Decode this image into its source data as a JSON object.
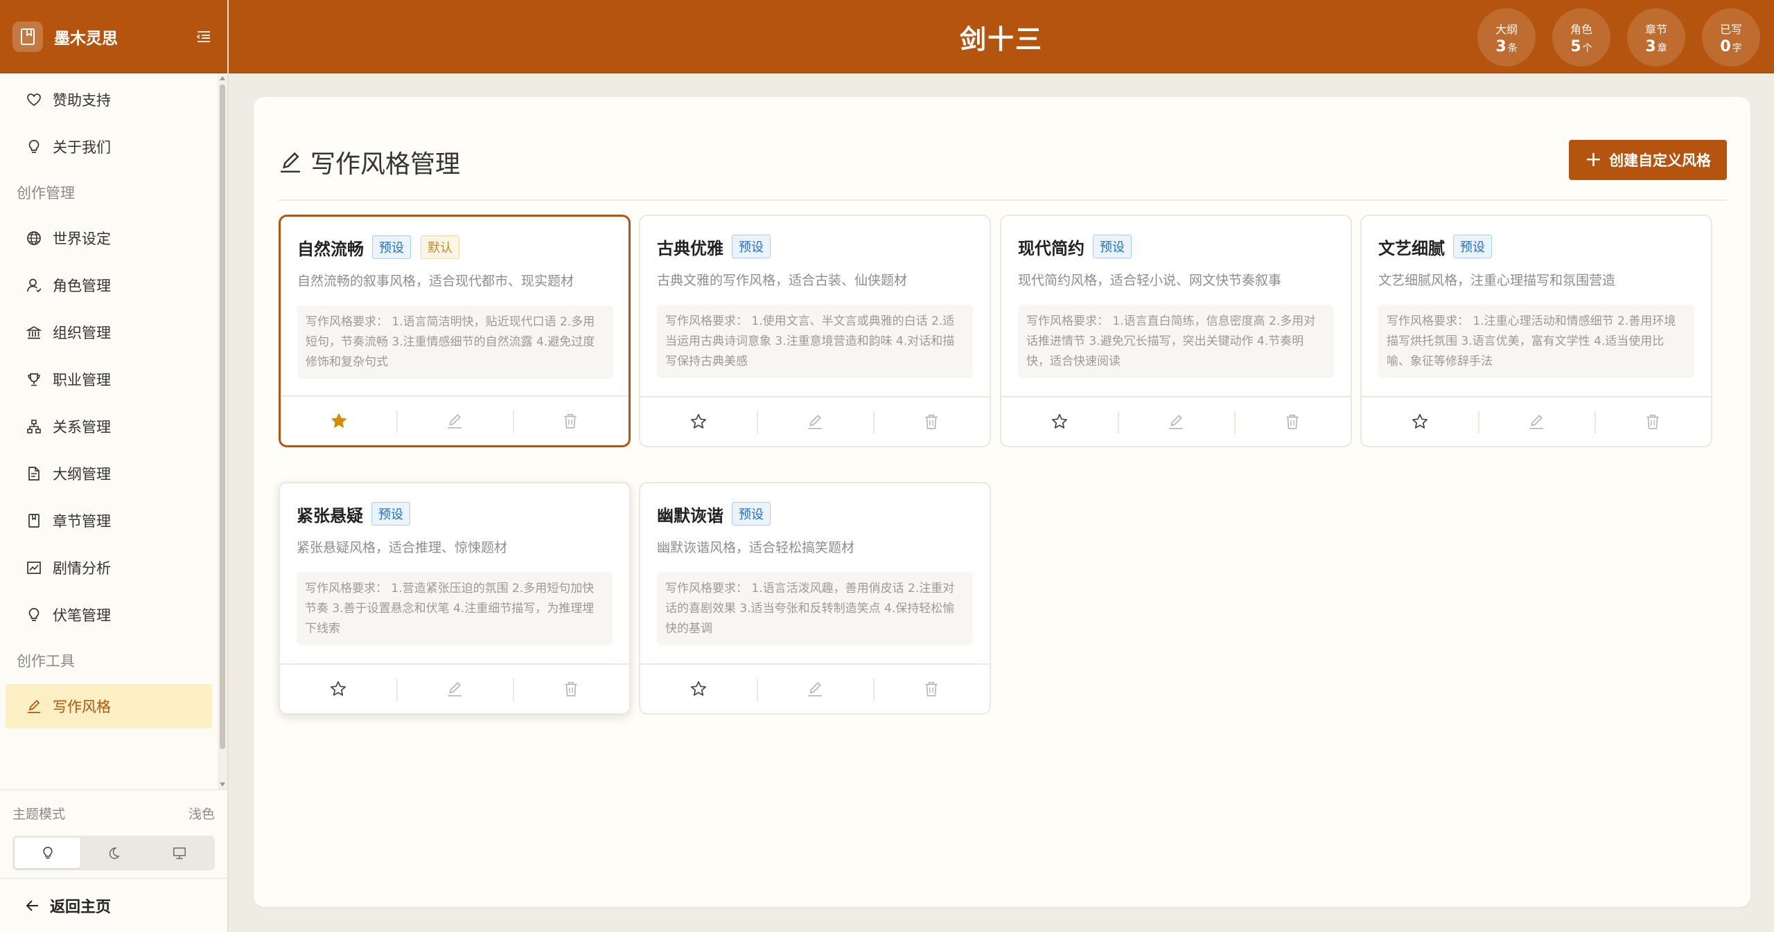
{
  "brand": {
    "name": "墨木灵思"
  },
  "header": {
    "title": "剑十三",
    "stats": [
      {
        "label": "大纲",
        "value": "3",
        "unit": "条"
      },
      {
        "label": "角色",
        "value": "5",
        "unit": "个"
      },
      {
        "label": "章节",
        "value": "3",
        "unit": "章"
      },
      {
        "label": "已写",
        "value": "0",
        "unit": "字"
      }
    ]
  },
  "sidebar": {
    "top_items": [
      {
        "label": "赞助支持",
        "icon": "heart-icon"
      },
      {
        "label": "关于我们",
        "icon": "lightbulb-icon"
      }
    ],
    "group_creation": "创作管理",
    "creation_items": [
      {
        "label": "世界设定",
        "icon": "globe-icon"
      },
      {
        "label": "角色管理",
        "icon": "user-icon"
      },
      {
        "label": "组织管理",
        "icon": "bank-icon"
      },
      {
        "label": "职业管理",
        "icon": "trophy-icon"
      },
      {
        "label": "关系管理",
        "icon": "cluster-icon"
      },
      {
        "label": "大纲管理",
        "icon": "file-text-icon"
      },
      {
        "label": "章节管理",
        "icon": "book-icon"
      },
      {
        "label": "剧情分析",
        "icon": "line-chart-icon"
      },
      {
        "label": "伏笔管理",
        "icon": "bulb-icon"
      }
    ],
    "group_tools": "创作工具",
    "tool_items": [
      {
        "label": "写作风格",
        "icon": "edit-icon",
        "active": true
      }
    ],
    "theme": {
      "label": "主题模式",
      "current": "浅色"
    },
    "back_label": "返回主页"
  },
  "main": {
    "title": "写作风格管理",
    "create_label": "创建自定义风格",
    "cards": [
      {
        "name": "自然流畅",
        "tags": [
          "预设",
          "默认"
        ],
        "desc": "自然流畅的叙事风格，适合现代都市、现实题材",
        "req": "写作风格要求： 1.语言简洁明快，贴近现代口语 2.多用短句，节奏流畅 3.注重情感细节的自然流露 4.避免过度修饰和复杂句式",
        "starred": true
      },
      {
        "name": "古典优雅",
        "tags": [
          "预设"
        ],
        "desc": "古典文雅的写作风格，适合古装、仙侠题材",
        "req": "写作风格要求： 1.使用文言、半文言或典雅的白话 2.适当运用古典诗词意象 3.注重意境营造和韵味 4.对话和描写保持古典美感",
        "starred": false
      },
      {
        "name": "现代简约",
        "tags": [
          "预设"
        ],
        "desc": "现代简约风格，适合轻小说、网文快节奏叙事",
        "req": "写作风格要求： 1.语言直白简练，信息密度高 2.多用对话推进情节 3.避免冗长描写，突出关键动作 4.节奏明快，适合快速阅读",
        "starred": false
      },
      {
        "name": "文艺细腻",
        "tags": [
          "预设"
        ],
        "desc": "文艺细腻风格，注重心理描写和氛围营造",
        "req": "写作风格要求： 1.注重心理活动和情感细节 2.善用环境描写烘托氛围 3.语言优美，富有文学性 4.适当使用比喻、象征等修辞手法",
        "starred": false
      },
      {
        "name": "紧张悬疑",
        "tags": [
          "预设"
        ],
        "desc": "紧张悬疑风格，适合推理、惊悚题材",
        "req": "写作风格要求： 1.营造紧张压迫的氛围 2.多用短句加快节奏 3.善于设置悬念和伏笔 4.注重细节描写，为推理埋下线索",
        "starred": false
      },
      {
        "name": "幽默诙谐",
        "tags": [
          "预设"
        ],
        "desc": "幽默诙谐风格，适合轻松搞笑题材",
        "req": "写作风格要求： 1.语言活泼风趣，善用俏皮话 2.注重对话的喜剧效果 3.适当夸张和反转制造笑点 4.保持轻松愉快的基调",
        "starred": false
      }
    ]
  },
  "colors": {
    "accent": "#b4540e",
    "active_bg": "#fdefc4",
    "preset_tag": "#1e6fd1",
    "default_tag": "#c6892a",
    "star": "#d38d0c"
  }
}
